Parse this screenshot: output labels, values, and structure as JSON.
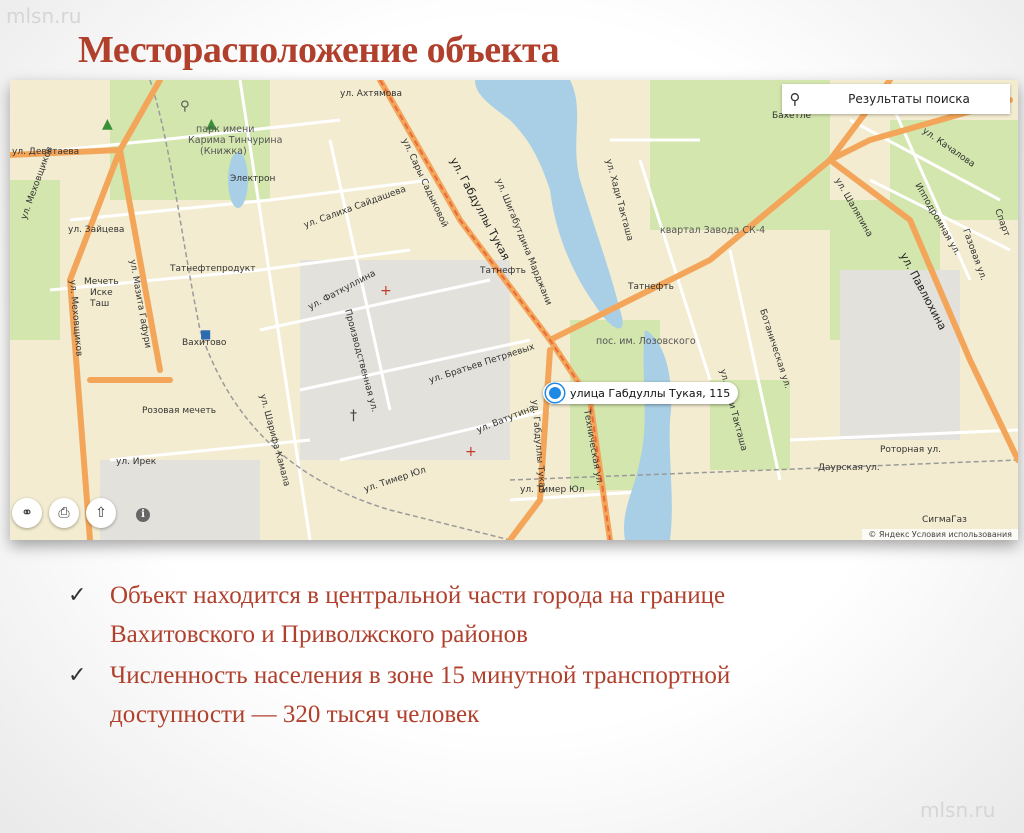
{
  "watermark": "mlsn.ru",
  "title": "Месторасположение объекта",
  "map": {
    "search_label": "Результаты поиска",
    "marker_label": "улица Габдуллы Тукая, 115",
    "copyright": "© Яндекс Условия использования",
    "controls": [
      "binoculars-icon",
      "print-icon",
      "share-icon",
      "info-icon"
    ],
    "labels": {
      "devyataeva": "ул. Девятаева",
      "park1": "парк имени",
      "park2": "Карима Тинчурина",
      "park3": "(Книжка)",
      "elektron": "Электрон",
      "zaitseva": "ул. Зайцева",
      "mechet1": "Мечеть",
      "mechet2": "Иске",
      "mechet3": "Таш",
      "mekhovshchikov": "ул. Меховщиков",
      "mazita": "ул. Мазита Гафури",
      "tatnefteprodukt": "Татнефтепродукт",
      "vakhitovo": "Вахитово",
      "rozovaya": "Розовая мечеть",
      "irek": "ул. Ирек",
      "akhtyamova": "ул. Ахтямова",
      "sary": "ул. Сары Садыковой",
      "salikha": "ул. Салиха Сайдашева",
      "fatkullina": "ул. Фаткуллина",
      "proizvodstvennaya": "Производственная ул.",
      "gabdully": "ул. Габдуллы Тукая",
      "tatneft1": "Татнефть",
      "shigabutdina": "ул. Шигабутдина Марджани",
      "bratyev": "ул. Братьев Петряевых",
      "sharifa": "ул. Шарифа Камала",
      "vatutina": "ул. Ватутина",
      "timer1": "ул. Тимер Юл",
      "timer2": "ул. Тимер Юл",
      "gabdully2": "ул. Габдуллы Тукая",
      "tekhnicheskaya": "Техническая ул.",
      "khadi": "ул. Хади Такташа",
      "khadi2": "ул. Хади Такташа",
      "kvartal": "квартал Завода СК-4",
      "tatneft2": "Татнефть",
      "pos": "пос. им. Лозовского",
      "bakhetle": "Бахетле",
      "kachalova": "ул. Качалова",
      "shalyapina": "ул. Шаляпина",
      "ippodromnaya": "Ипподромная ул.",
      "gazovaya": "Газовая ул.",
      "spartakovskaya": "Спарт",
      "pavlyukhina": "ул. Павлюхина",
      "botanicheskaya": "Ботаническая ул.",
      "rotornaya": "Роторная ул.",
      "daurskaya": "Даурская ул.",
      "sigmagaz": "СигмаГаз"
    }
  },
  "bullets": [
    {
      "line1": "Объект находится в центральной части города  на границе",
      "line2": "Вахитовского и Приволжского районов"
    },
    {
      "line1": "Численность населения в зоне 15 минутной транспортной",
      "line2": "доступности — 320 тысяч человек"
    }
  ],
  "colors": {
    "title": "#b0402c",
    "water": "#a8cfe6",
    "major_road": "#f3a65a",
    "park": "#cfe3a8",
    "marker": "#1e88e5"
  }
}
